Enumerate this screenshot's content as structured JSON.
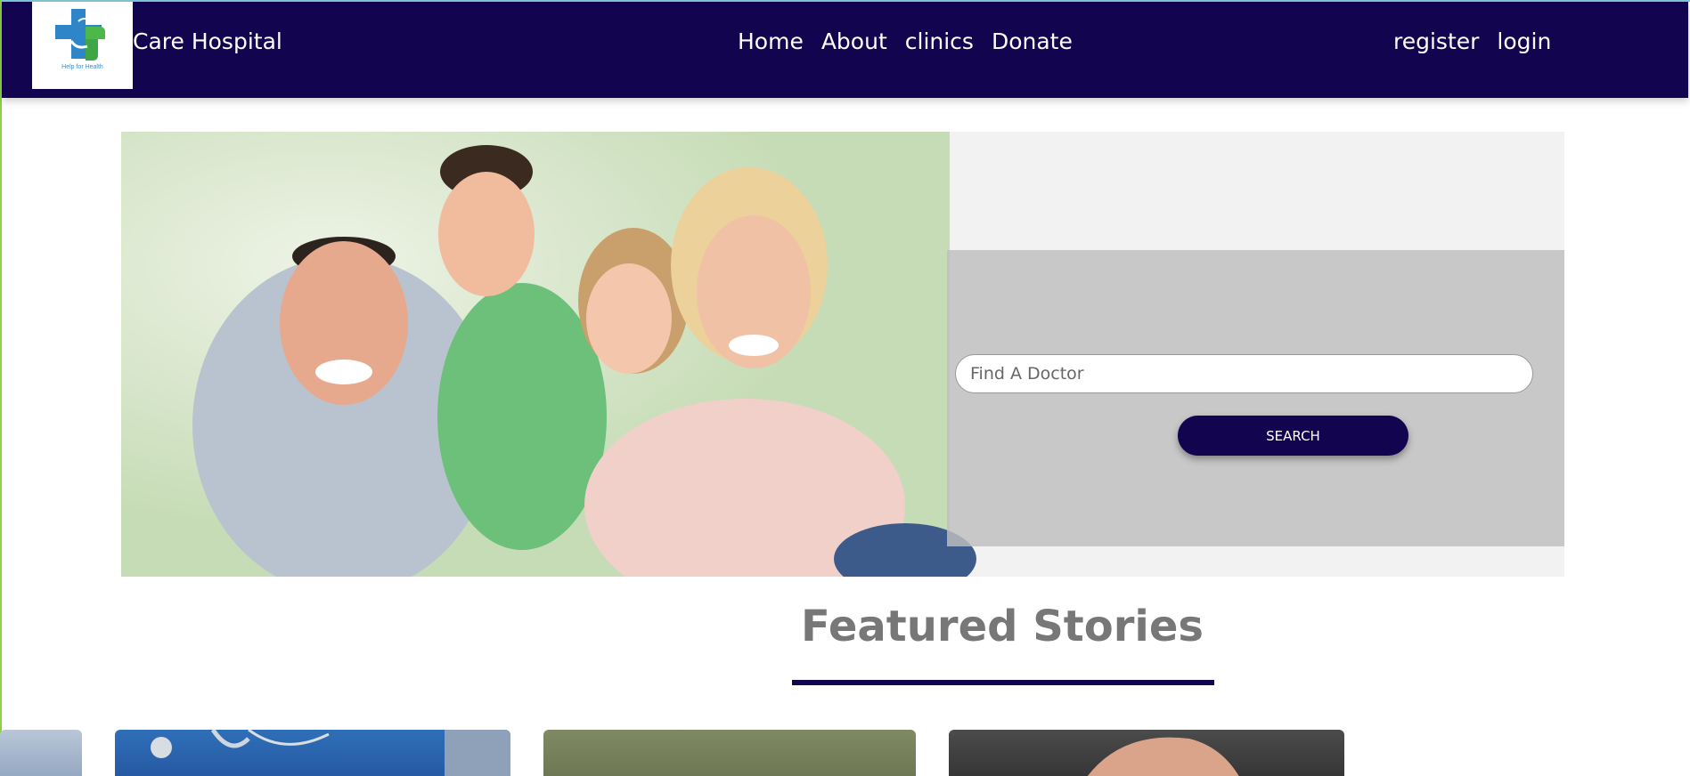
{
  "colors": {
    "navy": "#130450",
    "panel_gray": "#bebebe",
    "title_gray": "#777777"
  },
  "header": {
    "logo": {
      "icon": "medical-cross-hands-icon",
      "tagline": "Help for Health"
    },
    "brand_name": "Care Hospital",
    "nav_center": [
      {
        "label": "Home"
      },
      {
        "label": "About"
      },
      {
        "label": "clinics"
      },
      {
        "label": "Donate"
      }
    ],
    "nav_right": [
      {
        "label": "register"
      },
      {
        "label": "login"
      }
    ]
  },
  "hero": {
    "image": "family-photo",
    "search": {
      "placeholder": "Find A Doctor",
      "value": "",
      "button_label": "SEARCH"
    }
  },
  "featured": {
    "title": "Featured Stories",
    "cards": [
      {
        "image": "story-image"
      },
      {
        "image": "doctor-stethoscope-image"
      },
      {
        "image": "person-image"
      },
      {
        "image": "hands-image"
      }
    ]
  }
}
